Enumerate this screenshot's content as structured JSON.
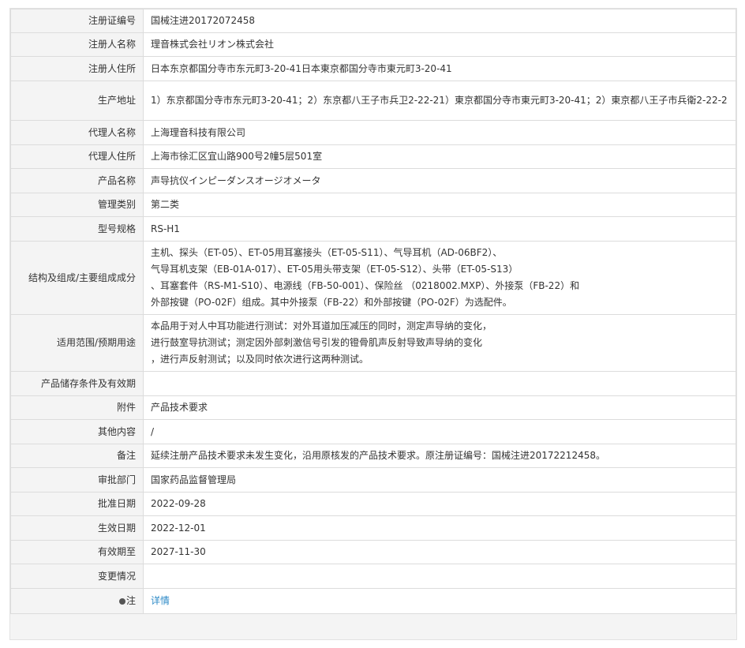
{
  "rows": {
    "reg_no": {
      "label": "注册证编号",
      "value": "国械注进20172072458"
    },
    "registrant": {
      "label": "注册人名称",
      "value": "理音株式会社リオン株式会社"
    },
    "registrant_addr": {
      "label": "注册人住所",
      "value": "日本东京都国分寺市东元町3-20-41日本東京都国分寺市東元町3-20-41"
    },
    "prod_addr": {
      "label": "生产地址",
      "value": "1）东京都国分寺市东元町3-20-41；2）东京都八王子市兵卫2-22-21）東京都国分寺市東元町3-20-41；2）東京都八王子市兵衛2-22-2"
    },
    "agent": {
      "label": "代理人名称",
      "value": "上海理音科技有限公司"
    },
    "agent_addr": {
      "label": "代理人住所",
      "value": "上海市徐汇区宜山路900号2幢5层501室"
    },
    "product": {
      "label": "产品名称",
      "value": "声导抗仪インピーダンスオージオメータ"
    },
    "category": {
      "label": "管理类别",
      "value": "第二类"
    },
    "model": {
      "label": "型号规格",
      "value": "RS-H1"
    },
    "structure": {
      "label": "结构及组成/主要组成成分",
      "lines": [
        "主机、探头（ET-05）、ET-05用耳塞接头（ET-05-S11）、气导耳机（AD-06BF2）、",
        "气导耳机支架（EB-01A-017）、ET-05用头带支架（ET-05-S12）、头带（ET-05-S13）",
        "、耳塞套件（RS-M1-S10）、电源线（FB-50-001）、保险丝 （0218002.MXP）、外接泵（FB-22）和",
        "外部按键（PO-02F）组成。其中外接泵（FB-22）和外部按键（PO-02F）为选配件。"
      ]
    },
    "scope": {
      "label": "适用范围/预期用途",
      "lines": [
        "本品用于对人中耳功能进行测试：对外耳道加压减压的同时，测定声导纳的变化，",
        "进行鼓室导抗测试；测定因外部刺激信号引发的镫骨肌声反射导致声导纳的变化",
        "，进行声反射测试；以及同时依次进行这两种测试。"
      ]
    },
    "storage": {
      "label": "产品储存条件及有效期",
      "value": ""
    },
    "attachment": {
      "label": "附件",
      "value": "产品技术要求"
    },
    "other": {
      "label": "其他内容",
      "value": "/"
    },
    "remark": {
      "label": "备注",
      "value": "延续注册产品技术要求未发生变化，沿用原核发的产品技术要求。原注册证编号：国械注进20172212458。"
    },
    "approver": {
      "label": "审批部门",
      "value": "国家药品监督管理局"
    },
    "approve_date": {
      "label": "批准日期",
      "value": "2022-09-28"
    },
    "effective_date": {
      "label": "生效日期",
      "value": "2022-12-01"
    },
    "expiry": {
      "label": "有效期至",
      "value": "2027-11-30"
    },
    "changes": {
      "label": "变更情况",
      "value": ""
    },
    "note": {
      "label": "注",
      "icon": "note-icon",
      "link": "详情"
    }
  },
  "colors": {
    "label_bg": "#f4f4f4",
    "border": "#dcdcdc",
    "link": "#2d8ac7",
    "text": "#333333"
  }
}
